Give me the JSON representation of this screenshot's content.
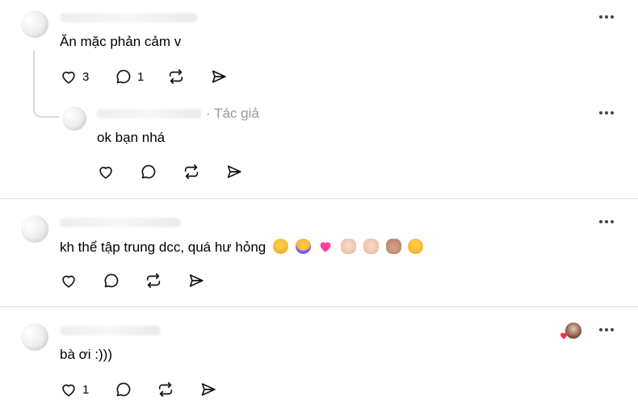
{
  "comment1": {
    "text": "Ăn mặc phản cảm v",
    "likes": "3",
    "replies": "1"
  },
  "reply1": {
    "author_tag": "· Tác giả",
    "text": "ok bạn nhá"
  },
  "comment2": {
    "text": "kh thể tập trung dcc, quá hư hỏng",
    "emojis": [
      "pensive-face-emoji",
      "crying-face-emoji",
      "heart-emoji",
      "waving-hand-emoji",
      "pinching-hand-emoji",
      "heart-hands-emoji",
      "hugging-face-emoji"
    ]
  },
  "comment3": {
    "text": "bà ơi :)))",
    "likes": "1"
  },
  "colors": {
    "text": "#000000",
    "muted": "#999999",
    "divider": "#dcdcdc",
    "heart_red": "#ff2d55"
  }
}
